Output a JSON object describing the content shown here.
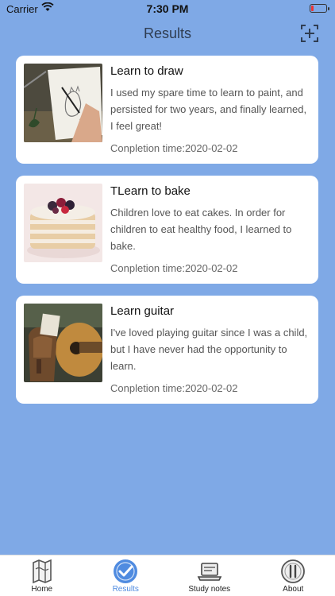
{
  "status_bar": {
    "carrier": "Carrier",
    "time": "7:30 PM"
  },
  "nav": {
    "title": "Results"
  },
  "cards": [
    {
      "title": "Learn to draw",
      "description": "I used my spare time to learn to paint, and persisted for two years, and finally learned, I feel great!",
      "completion": "Conpletion time:2020-02-02"
    },
    {
      "title": "TLearn to bake",
      "description": "Children love to eat cakes. In order for children to eat healthy food, I learned to bake.",
      "completion": "Conpletion time:2020-02-02"
    },
    {
      "title": "Learn guitar",
      "description": "I've loved playing guitar since I was a child, but I have never had the opportunity to learn.",
      "completion": "Conpletion time:2020-02-02"
    }
  ],
  "tabs": [
    {
      "label": "Home",
      "icon": "map-icon",
      "active": false
    },
    {
      "label": "Results",
      "icon": "check-badge-icon",
      "active": true
    },
    {
      "label": "Study notes",
      "icon": "laptop-icon",
      "active": false
    },
    {
      "label": "About",
      "icon": "about-icon",
      "active": false
    }
  ],
  "colors": {
    "background": "#7FA9E6",
    "accent": "#4f8be0"
  }
}
